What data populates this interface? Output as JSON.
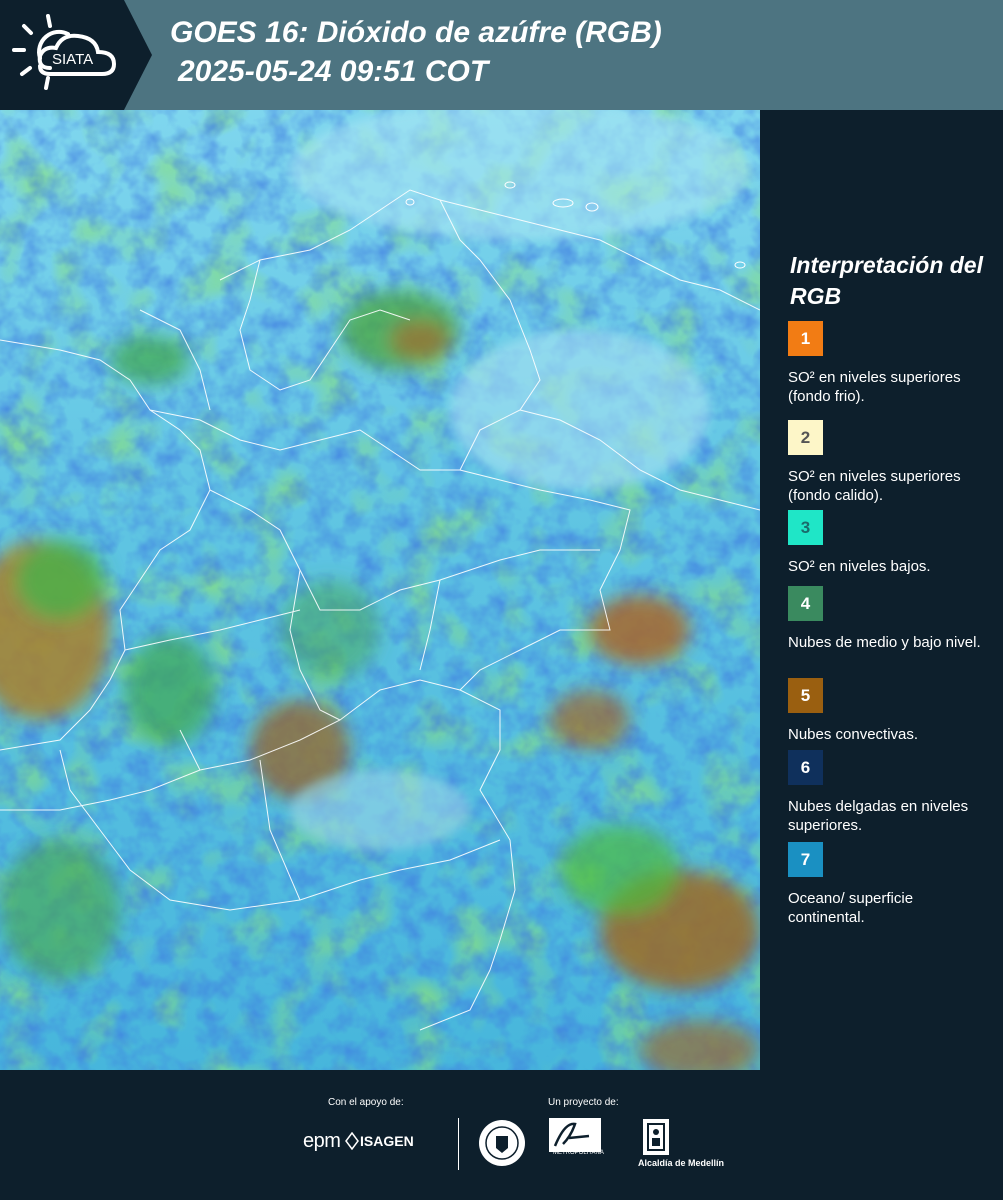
{
  "header": {
    "logo_text": "SIATA",
    "title_line1": "GOES 16: Dióxido de azúfre (RGB)",
    "title_line2": "2025-05-24 09:51 COT"
  },
  "legend": {
    "title": "Interpretación del RGB",
    "items": [
      {
        "number": "1",
        "color": "#f27c14",
        "text_color": "#ffffff",
        "text": "SO² en niveles superiores (fondo frio)."
      },
      {
        "number": "2",
        "color": "#fdf6c8",
        "text_color": "#555555",
        "text": "SO² en niveles superiores (fondo calido)."
      },
      {
        "number": "3",
        "color": "#1fe6c7",
        "text_color": "#1a6b6b",
        "text": "SO² en niveles bajos."
      },
      {
        "number": "4",
        "color": "#3a8a5f",
        "text_color": "#ffffff",
        "text": "Nubes de medio y bajo nivel."
      },
      {
        "number": "5",
        "color": "#9a5f10",
        "text_color": "#ffffff",
        "text": "Nubes convectivas."
      },
      {
        "number": "6",
        "color": "#0f305c",
        "text_color": "#ffffff",
        "text": "Nubes delgadas en niveles superiores."
      },
      {
        "number": "7",
        "color": "#1a90c2",
        "text_color": "#ffffff",
        "text": "Oceano/ superficie continental."
      }
    ]
  },
  "footer": {
    "support_label": "Con el apoyo de:",
    "project_label": "Un proyecto de:",
    "epm_text": "epm",
    "isagen_text": "ISAGEN",
    "area_text": "METROPOLITANA",
    "alcaldia_text": "Alcaldía de Medellín"
  }
}
